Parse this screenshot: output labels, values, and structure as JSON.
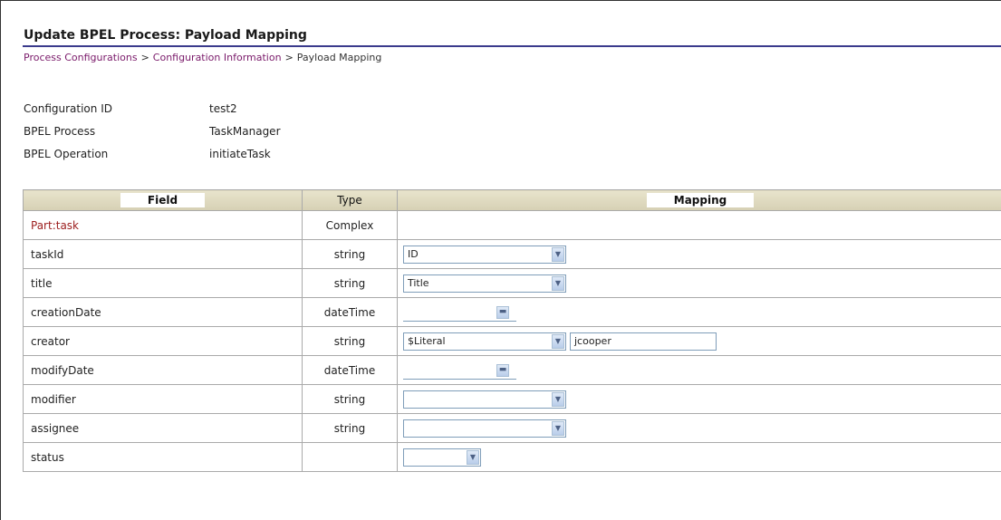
{
  "page": {
    "title": "Update BPEL Process: Payload Mapping",
    "breadcrumbs": [
      "Process Configurations",
      "Configuration Information",
      "Payload Mapping"
    ],
    "breadcrumb_sep": ">"
  },
  "info": [
    {
      "label": "Configuration ID",
      "value": "test2"
    },
    {
      "label": "BPEL Process",
      "value": "TaskManager"
    },
    {
      "label": "BPEL Operation",
      "value": "initiateTask"
    }
  ],
  "table": {
    "headers": {
      "field": "Field",
      "type": "Type",
      "mapping": "Mapping"
    },
    "rows": [
      {
        "field": "Part:task",
        "type": "Complex"
      },
      {
        "field": "taskId",
        "type": "string",
        "select": "ID"
      },
      {
        "field": "title",
        "type": "string",
        "select": "Title"
      },
      {
        "field": "creationDate",
        "type": "dateTime"
      },
      {
        "field": "creator",
        "type": "string",
        "select": "$Literal",
        "text": "jcooper"
      },
      {
        "field": "modifyDate",
        "type": "dateTime"
      },
      {
        "field": "modifier",
        "type": "string",
        "select": ""
      },
      {
        "field": "assignee",
        "type": "string",
        "select": ""
      },
      {
        "field": "status",
        "type": "",
        "select": ""
      }
    ]
  },
  "icons": {
    "dropdown": "chevron-down-icon",
    "date_picker": "calendar-icon"
  },
  "colors": {
    "accent": "#3a3a8c",
    "link": "#7a1a6a",
    "part_label": "#9b1c1c",
    "header_bg": "#d6d0b4"
  }
}
